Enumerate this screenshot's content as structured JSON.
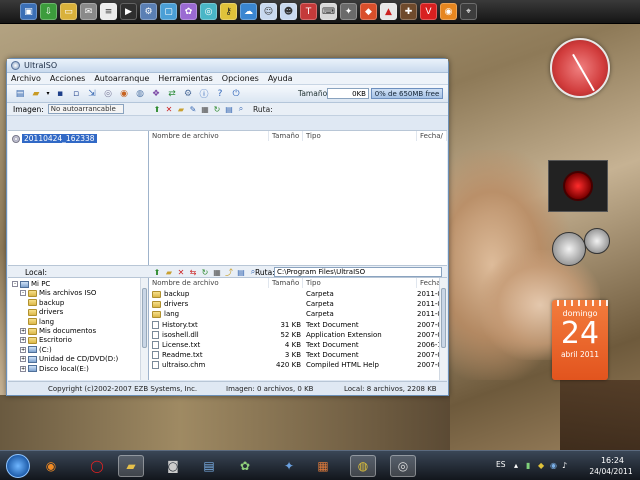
{
  "window": {
    "title": "UltraISO"
  },
  "menu": [
    "Archivo",
    "Acciones",
    "Autoarranque",
    "Herramientas",
    "Opciones",
    "Ayuda"
  ],
  "toolbar": {
    "size_label": "Tamaño:",
    "size_value": "0KB",
    "free_text": "0% de 650MB free"
  },
  "image_bar": {
    "label": "Imagen:",
    "value": "No autoarrancable",
    "ruta_label": "Ruta:"
  },
  "iso_tree": {
    "root_label": "20110424_162338"
  },
  "iso_list": {
    "headers": [
      "Nombre de archivo",
      "Tamaño",
      "Tipo",
      "Fecha/"
    ]
  },
  "local_bar": {
    "label": "Local:",
    "ruta_label": "Ruta:",
    "ruta_value": "C:\\Program Files\\UltraISO"
  },
  "local_tree": [
    {
      "label": "Mi PC",
      "icon": "pc-icon",
      "indent": 0,
      "expander": "-"
    },
    {
      "label": "Mis archivos ISO",
      "icon": "folder-icon",
      "indent": 1,
      "expander": "-"
    },
    {
      "label": "backup",
      "icon": "folder-icon",
      "indent": 2,
      "expander": ""
    },
    {
      "label": "drivers",
      "icon": "folder-icon",
      "indent": 2,
      "expander": ""
    },
    {
      "label": "lang",
      "icon": "folder-icon",
      "indent": 2,
      "expander": ""
    },
    {
      "label": "Mis documentos",
      "icon": "folder-icon",
      "indent": 1,
      "expander": "+"
    },
    {
      "label": "Escritorio",
      "icon": "folder-icon",
      "indent": 1,
      "expander": "+"
    },
    {
      "label": "(C:)",
      "icon": "drive-icon",
      "indent": 1,
      "expander": "+"
    },
    {
      "label": "Unidad de CD/DVD(D:)",
      "icon": "cd-drive-icon",
      "indent": 1,
      "expander": "+"
    },
    {
      "label": "Disco local(E:)",
      "icon": "drive-icon",
      "indent": 1,
      "expander": "+"
    }
  ],
  "local_list": {
    "headers": [
      "Nombre de archivo",
      "Tamaño",
      "Tipo",
      "Fecha"
    ],
    "rows": [
      {
        "name": "backup",
        "size": "",
        "type": "Carpeta",
        "date": "2011-0",
        "icon": "folder-icon"
      },
      {
        "name": "drivers",
        "size": "",
        "type": "Carpeta",
        "date": "2011-0",
        "icon": "folder-icon"
      },
      {
        "name": "lang",
        "size": "",
        "type": "Carpeta",
        "date": "2011-0",
        "icon": "folder-icon"
      },
      {
        "name": "History.txt",
        "size": "31 KB",
        "type": "Text Document",
        "date": "2007-0",
        "icon": "text-file-icon"
      },
      {
        "name": "isoshell.dll",
        "size": "52 KB",
        "type": "Application Extension",
        "date": "2007-0",
        "icon": "dll-file-icon"
      },
      {
        "name": "License.txt",
        "size": "4 KB",
        "type": "Text Document",
        "date": "2006-1",
        "icon": "text-file-icon"
      },
      {
        "name": "Readme.txt",
        "size": "3 KB",
        "type": "Text Document",
        "date": "2007-0",
        "icon": "text-file-icon"
      },
      {
        "name": "ultraiso.chm",
        "size": "420 KB",
        "type": "Compiled HTML Help",
        "date": "2007-0",
        "icon": "help-file-icon"
      }
    ]
  },
  "status": {
    "copyright": "Copyright (c)2002-2007 EZB Systems, Inc.",
    "image_info": "Imagen: 0 archivos, 0 KB",
    "local_info": "Local: 8 archivos, 2208 KB"
  },
  "calendar": {
    "day_name": "domingo",
    "day": "24",
    "month_year": "abril 2011"
  },
  "taskbar": {
    "lang": "ES",
    "time": "16:24",
    "date": "24/04/2011"
  },
  "colors": {
    "selection": "#3169c6",
    "calendar": "#e85f25",
    "clock_face": "#d13c3c"
  }
}
